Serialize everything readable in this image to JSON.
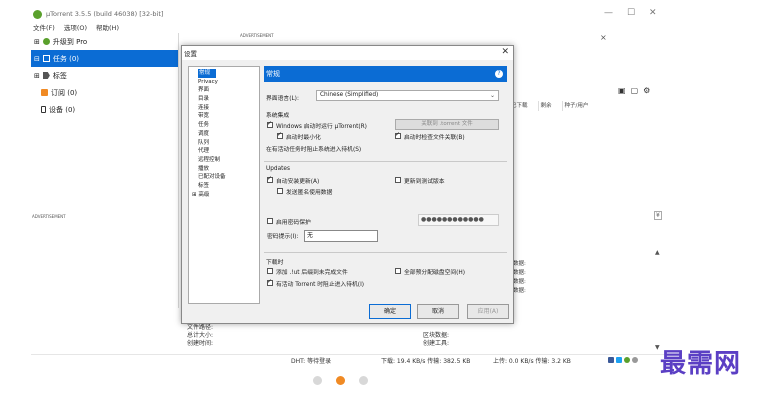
{
  "app": {
    "title": "µTorrent 3.5.5  (build 46038) [32-bit]",
    "menu": [
      "文件(F)",
      "选项(O)",
      "帮助(H)"
    ],
    "window_controls": [
      "—",
      "☐",
      "✕"
    ]
  },
  "sidebar": {
    "items": [
      {
        "prefix": "⊞",
        "label": "升级到 Pro"
      },
      {
        "prefix": "⊟",
        "label": "任务 (0)"
      },
      {
        "prefix": "⊞",
        "label": "标签"
      },
      {
        "prefix": "",
        "label": "订阅 (0)"
      },
      {
        "prefix": "",
        "label": "设备 (0)"
      }
    ]
  },
  "main": {
    "advertisement_top": "ADVERTISEMENT",
    "advertisement_left": "ADVERTISEMENT",
    "columns": [
      "已下载",
      "剩余",
      "种子/用户"
    ],
    "side_labels": [
      "数据:",
      "数据:",
      "数据:",
      "数据:"
    ],
    "info_left": [
      "文件路径:",
      "总计大小:",
      "创建时间:"
    ],
    "info_mid": [
      "区块数据:",
      "创建工具:"
    ],
    "status": {
      "dht": "DHT: 等待登录",
      "down": "下载: 19.4 KB/s 传输: 382.5 KB",
      "up": "上传: 0.0 KB/s 传输: 3.2 KB"
    },
    "close_x": "×",
    "scroll_toggle": "¥"
  },
  "dialog": {
    "title": "设置",
    "close": "✕",
    "tree": [
      {
        "label": "常规",
        "selected": true,
        "expandable": false
      },
      {
        "label": "Privacy",
        "selected": false,
        "expandable": false
      },
      {
        "label": "界面",
        "selected": false,
        "expandable": false
      },
      {
        "label": "目录",
        "selected": false,
        "expandable": false
      },
      {
        "label": "连接",
        "selected": false,
        "expandable": false
      },
      {
        "label": "带宽",
        "selected": false,
        "expandable": false
      },
      {
        "label": "任务",
        "selected": false,
        "expandable": false
      },
      {
        "label": "调度",
        "selected": false,
        "expandable": false
      },
      {
        "label": "队列",
        "selected": false,
        "expandable": false
      },
      {
        "label": "代理",
        "selected": false,
        "expandable": false
      },
      {
        "label": "远程控制",
        "selected": false,
        "expandable": false
      },
      {
        "label": "播放",
        "selected": false,
        "expandable": false
      },
      {
        "label": "已配对设备",
        "selected": false,
        "expandable": false
      },
      {
        "label": "标签",
        "selected": false,
        "expandable": false
      },
      {
        "label": "高级",
        "selected": false,
        "expandable": true
      }
    ],
    "pane_title": "常规",
    "help": "?",
    "language_label": "界面语言(L):",
    "language_value": "Chinese (Simplified)",
    "system_section": "系统集成",
    "start_with_windows": "Windows 启动时运行 µTorrent(R)",
    "start_minimized": "启动时最小化",
    "check_association": "启动时检查文件关联(B)",
    "associate_button": "关联到 .torrent 文件",
    "prevent_standby_text": "在有活动任务时阻止系统进入待机(S)",
    "updates_section": "Updates",
    "auto_update": "自动安装更新(A)",
    "beta_update": "更新到测试版本",
    "send_info": "发送匿名使用数据",
    "password_protect": "启用密码保护",
    "password_value": "●●●●●●●●●●●●",
    "password_hint_label": "密码提示(I):",
    "password_hint_value": "无",
    "download_section": "下载时",
    "append_ut": "添加 .!ut 后缀到未完成文件",
    "preallocate": "全部预分配磁盘空间(H)",
    "prevent_standby": "有活动 Torrent 时阻止进入待机(I)",
    "buttons": {
      "ok": "确定",
      "cancel": "取消",
      "apply": "应用(A)"
    }
  },
  "watermark": "最需网",
  "colors": {
    "accent": "#0b6cd4",
    "dot_active": "#f08a24",
    "watermark": "#5b3fc4"
  }
}
